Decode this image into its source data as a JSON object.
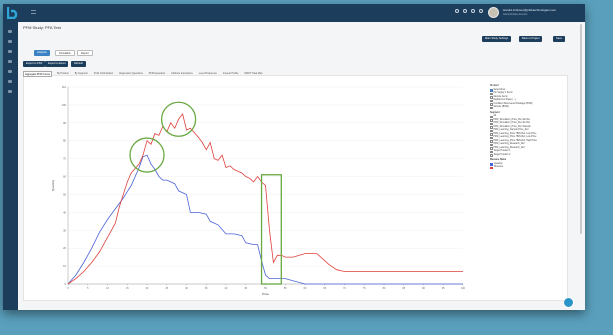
{
  "topbar": {
    "user_name": "Harold Johnson@pfsbtechnologies.com",
    "user_role": "Administrative Account",
    "icons": [
      "settings-icon",
      "notifications-icon",
      "mail-icon",
      "help-icon"
    ]
  },
  "sidebar": {
    "icons": [
      "dashboard-icon",
      "projects-icon",
      "analysis-icon",
      "reports-icon",
      "files-icon",
      "settings-icon",
      "help-icon"
    ]
  },
  "page": {
    "title": "PFM Study: PFA Test"
  },
  "header_buttons": {
    "main_study_settings": "Main Study Settings",
    "back_to_project": "Back to Project",
    "save": "Save"
  },
  "view_tabs": {
    "analysis": "Analysis",
    "simulation": "Simulation",
    "report": "Report"
  },
  "export": {
    "pdf": "Export to PDF",
    "excel": "Export to Excel",
    "refresh": "Refresh"
  },
  "result_tabs": [
    "Aggregate PFM Curves",
    "By Product",
    "By Segment",
    "Profit Optimization",
    "Regression Questions",
    "PFM Questions",
    "Attribute Importance",
    "Level Preference",
    "Interest Profile",
    "SWOT Heat Map"
  ],
  "active_result_tab": 0,
  "legend": {
    "product_header": "Product",
    "products": [
      {
        "label": "Select Row",
        "checked": true
      },
      {
        "label": "Pic Supply 1 Items",
        "checked": false
      },
      {
        "label": "Sample Items",
        "checked": false
      },
      {
        "label": "Digital Item Share (...)",
        "checked": false
      },
      {
        "label": "Confident Discovered Package (BOM)",
        "checked": false
      },
      {
        "label": "Sample (BOM)",
        "checked": false
      }
    ],
    "segment_header": "Segment",
    "segments": [
      {
        "label": "All",
        "checked": false
      },
      {
        "label": "PFM_Simulation_Price_Run Ref Ex",
        "checked": false
      },
      {
        "label": "PFM_Simulation_Price_Run Ex Ref",
        "checked": false
      },
      {
        "label": "PFM_Simulation_Price_Run Sample",
        "checked": false
      },
      {
        "label": "PFM_Learning_Sample Price_Ref",
        "checked": false
      },
      {
        "label": "PFM_Learning_Price HMS Ref, Low Price",
        "checked": false
      },
      {
        "label": "PFM_Learning_Price HMS Ref, Low Price",
        "checked": false
      },
      {
        "label": "PFM_Learning_Price HMS Ref, High Price",
        "checked": false
      },
      {
        "label": "PFM_Learning_Research_Ref",
        "checked": false
      },
      {
        "label": "PFM_Learning_Research_Ref",
        "checked": false
      },
      {
        "label": "Target Product 1",
        "checked": false
      },
      {
        "label": "Target Product 2",
        "checked": false
      }
    ],
    "measure_header": "Measure Name",
    "measures": [
      {
        "label": "Quantity",
        "color": "#4a63d8"
      },
      {
        "label": "Revenue",
        "color": "#e0403a"
      }
    ]
  },
  "chart_data": {
    "type": "line",
    "xlabel": "Price",
    "ylabel": "Quantity",
    "ylim": [
      0,
      110
    ],
    "xlim": [
      0,
      100
    ],
    "grid": true,
    "series": [
      {
        "name": "Quantity",
        "color": "#4a63d8",
        "points": [
          [
            0,
            0
          ],
          [
            2,
            5
          ],
          [
            4,
            12
          ],
          [
            6,
            20
          ],
          [
            8,
            29
          ],
          [
            10,
            36
          ],
          [
            12,
            42
          ],
          [
            14,
            48
          ],
          [
            16,
            55
          ],
          [
            18,
            65
          ],
          [
            19,
            71
          ],
          [
            20,
            72
          ],
          [
            21,
            67
          ],
          [
            22,
            64
          ],
          [
            23,
            60
          ],
          [
            24,
            58
          ],
          [
            25,
            58
          ],
          [
            26,
            57
          ],
          [
            27,
            56
          ],
          [
            28,
            52
          ],
          [
            30,
            50
          ],
          [
            31,
            40
          ],
          [
            33,
            40
          ],
          [
            35,
            39
          ],
          [
            36,
            35
          ],
          [
            38,
            33
          ],
          [
            40,
            28
          ],
          [
            42,
            28
          ],
          [
            44,
            27
          ],
          [
            45,
            23
          ],
          [
            47,
            22
          ],
          [
            48,
            22
          ],
          [
            49,
            13
          ],
          [
            50,
            5
          ],
          [
            51,
            3
          ],
          [
            54,
            3
          ],
          [
            55,
            3
          ],
          [
            60,
            0
          ],
          [
            100,
            0
          ]
        ]
      },
      {
        "name": "Revenue",
        "color": "#e0403a",
        "points": [
          [
            0,
            0
          ],
          [
            2,
            3
          ],
          [
            4,
            7
          ],
          [
            6,
            12
          ],
          [
            8,
            18
          ],
          [
            10,
            26
          ],
          [
            12,
            34
          ],
          [
            13,
            43
          ],
          [
            14,
            50
          ],
          [
            15,
            57
          ],
          [
            16,
            62
          ],
          [
            18,
            67
          ],
          [
            19,
            72
          ],
          [
            20,
            80
          ],
          [
            21,
            78
          ],
          [
            22,
            84
          ],
          [
            23,
            83
          ],
          [
            24,
            88
          ],
          [
            25,
            85
          ],
          [
            26,
            90
          ],
          [
            27,
            87
          ],
          [
            28,
            92
          ],
          [
            29,
            95
          ],
          [
            30,
            86
          ],
          [
            31,
            87
          ],
          [
            33,
            82
          ],
          [
            34,
            79
          ],
          [
            35,
            75
          ],
          [
            36,
            79
          ],
          [
            37,
            70
          ],
          [
            38,
            69
          ],
          [
            39,
            72
          ],
          [
            40,
            65
          ],
          [
            41,
            66
          ],
          [
            42,
            64
          ],
          [
            43,
            63
          ],
          [
            44,
            62
          ],
          [
            45,
            60
          ],
          [
            46,
            59
          ],
          [
            47,
            57
          ],
          [
            48,
            60
          ],
          [
            49,
            57
          ],
          [
            50,
            55
          ],
          [
            51,
            30
          ],
          [
            52,
            12
          ],
          [
            53,
            16
          ],
          [
            54,
            16
          ],
          [
            55,
            15
          ],
          [
            57,
            15
          ],
          [
            60,
            17
          ],
          [
            63,
            17
          ],
          [
            66,
            11
          ],
          [
            68,
            8
          ],
          [
            70,
            7
          ],
          [
            75,
            7
          ],
          [
            100,
            7
          ]
        ]
      }
    ],
    "highlights": [
      {
        "shape": "circle",
        "label": "",
        "x": 20,
        "y": 72
      },
      {
        "shape": "circle",
        "label": "",
        "x": 28,
        "y": 92
      },
      {
        "shape": "rectangle",
        "label": "",
        "x": [
          49,
          54
        ],
        "y": [
          0,
          61
        ]
      }
    ],
    "highlight_color": "#6aa842"
  }
}
